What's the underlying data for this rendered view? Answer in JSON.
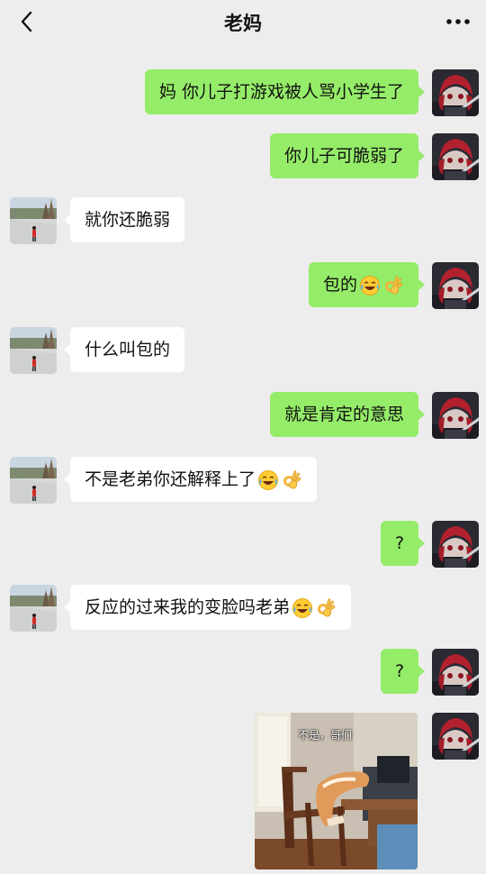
{
  "header": {
    "title": "老妈",
    "back_icon": "chevron-left-icon",
    "more_icon": "more-dots-icon"
  },
  "messages": [
    {
      "side": "right",
      "text": "妈 你儿子打游戏被人骂小学生了",
      "emojis": []
    },
    {
      "side": "right",
      "text": "你儿子可脆弱了",
      "emojis": []
    },
    {
      "side": "left",
      "text": "就你还脆弱",
      "emojis": []
    },
    {
      "side": "right",
      "text": "包的",
      "emojis": [
        "laughing-crying-emoji",
        "ok-hand-emoji"
      ]
    },
    {
      "side": "left",
      "text": "什么叫包的",
      "emojis": []
    },
    {
      "side": "right",
      "text": "就是肯定的意思",
      "emojis": []
    },
    {
      "side": "left",
      "text": "不是老弟你还解释上了",
      "emojis": [
        "laughing-crying-emoji",
        "ok-hand-emoji"
      ]
    },
    {
      "side": "right",
      "text": "?",
      "emojis": []
    },
    {
      "side": "left",
      "text": "反应的过来我的变脸吗老弟",
      "emojis": [
        "laughing-crying-emoji",
        "ok-hand-emoji"
      ]
    },
    {
      "side": "right",
      "text": "?",
      "emojis": []
    }
  ],
  "image_message": {
    "side": "right",
    "caption": "不是，哥们"
  },
  "colors": {
    "background": "#ededed",
    "right_bubble": "#95ec69",
    "left_bubble": "#ffffff"
  }
}
